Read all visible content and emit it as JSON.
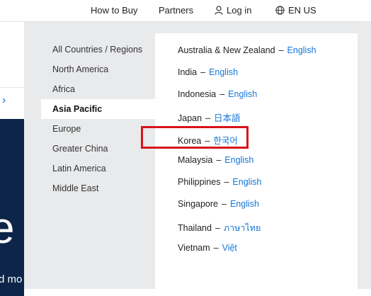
{
  "topbar": {
    "how_to_buy": "How to Buy",
    "partners": "Partners",
    "login": "Log in",
    "language": "EN US"
  },
  "background": {
    "big_letter": "e",
    "small_text": "d mo",
    "chevron": "›"
  },
  "regions": [
    {
      "label": "All Countries / Regions",
      "active": false
    },
    {
      "label": "North America",
      "active": false
    },
    {
      "label": "Africa",
      "active": false
    },
    {
      "label": "Asia Pacific",
      "active": true
    },
    {
      "label": "Europe",
      "active": false
    },
    {
      "label": "Greater China",
      "active": false
    },
    {
      "label": "Latin America",
      "active": false
    },
    {
      "label": "Middle East",
      "active": false
    }
  ],
  "countries": [
    {
      "name": "Australia & New Zealand",
      "lang": "English"
    },
    {
      "name": "India",
      "lang": "English"
    },
    {
      "name": "Indonesia",
      "lang": "English"
    },
    {
      "name": "Japan",
      "lang": "日本語"
    },
    {
      "name": "Korea",
      "lang": "한국어"
    },
    {
      "name": "Malaysia",
      "lang": "English"
    },
    {
      "name": "Philippines",
      "lang": "English"
    },
    {
      "name": "Singapore",
      "lang": "English"
    },
    {
      "name": "Thailand",
      "lang": "ภาษาไทย"
    },
    {
      "name": "Vietnam",
      "lang": "Việt"
    }
  ],
  "separator": "–",
  "colors": {
    "link": "#1477d8",
    "highlight_box": "#d7141a",
    "menu_bg": "#e9eaec",
    "navy": "#0c2548"
  },
  "icons": {
    "login": "user-icon",
    "language": "globe-icon"
  }
}
